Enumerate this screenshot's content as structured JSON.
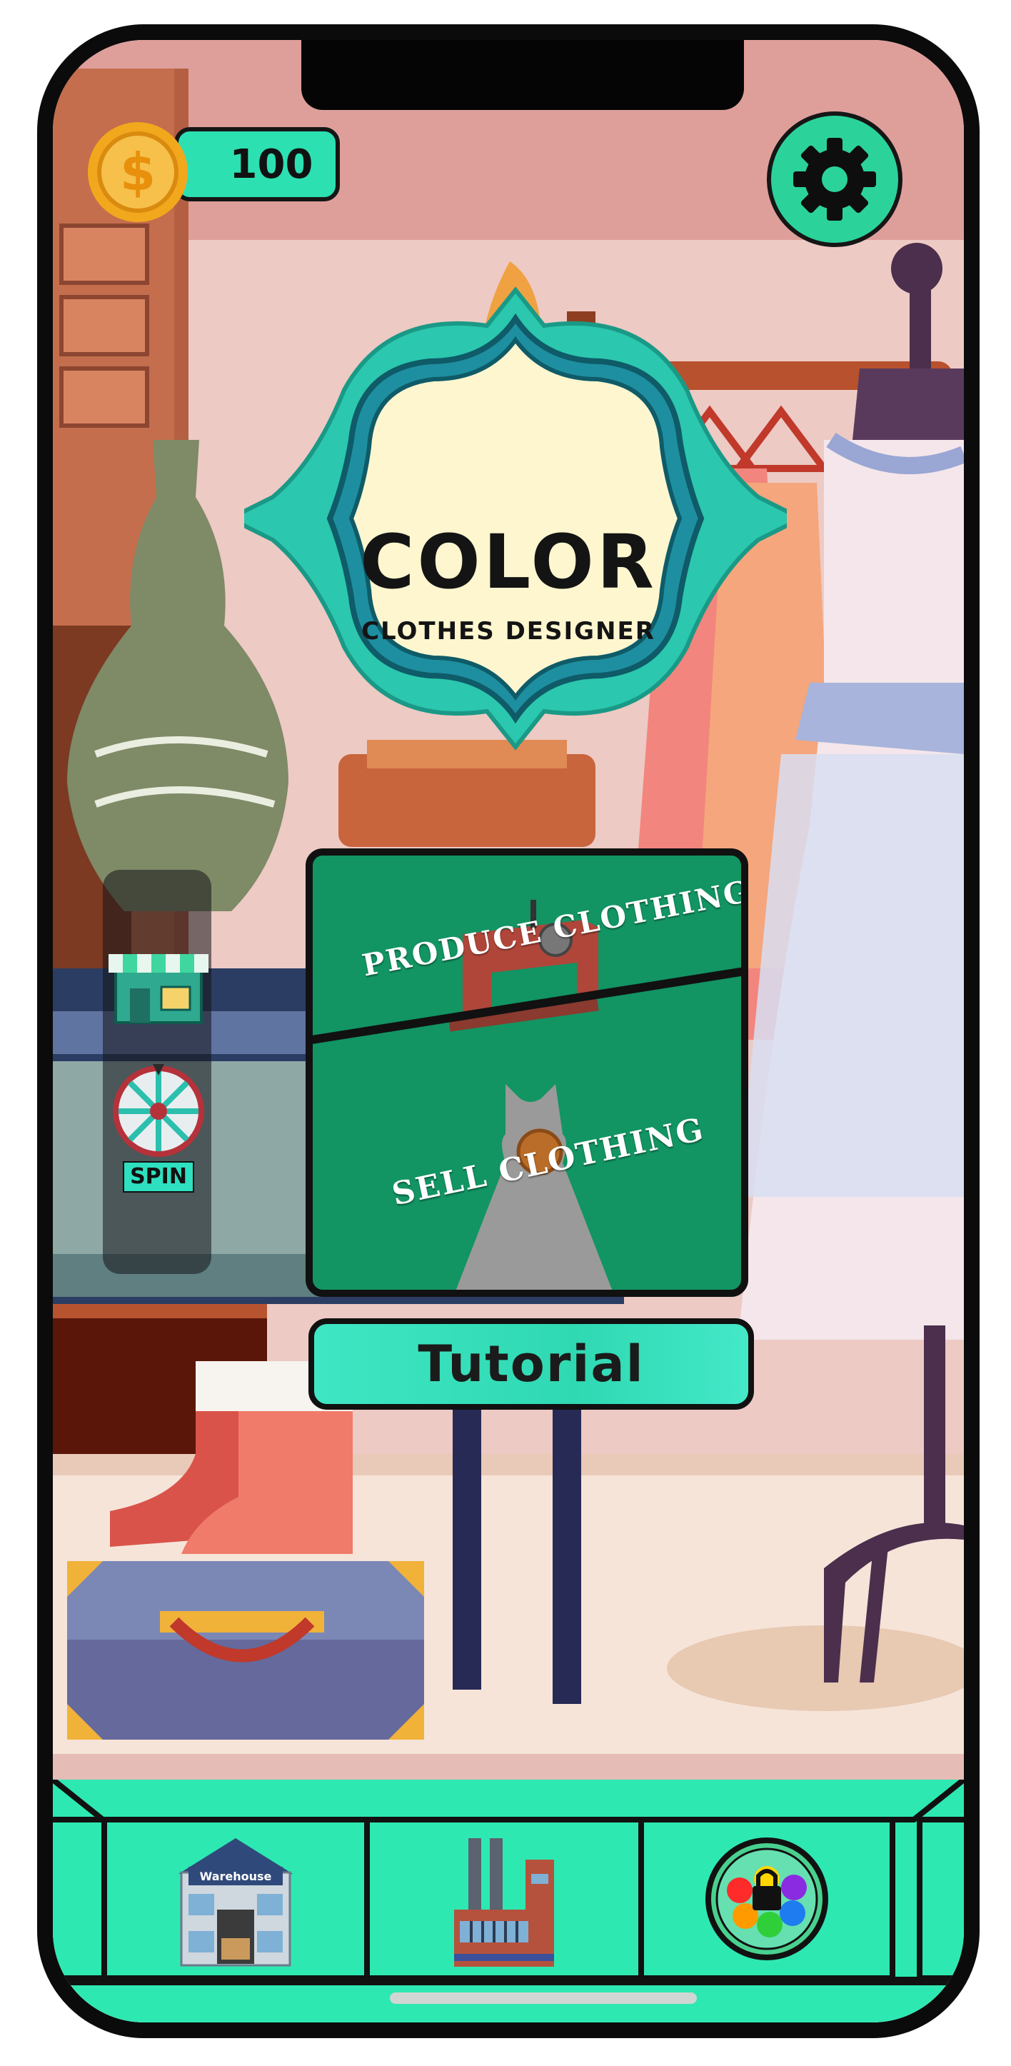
{
  "hud": {
    "coin_icon": "dollar-coin-icon",
    "coins": "100",
    "settings_icon": "gear-icon"
  },
  "title": {
    "main": "COLOR",
    "sub": "CLOTHES DESIGNER"
  },
  "side_menu": {
    "shop_icon": "shop-icon",
    "spin_icon": "wheel-icon",
    "spin_label": "SPIN"
  },
  "actions": {
    "produce_label": "PRODUCE CLOTHING",
    "produce_icon": "sewing-machine-icon",
    "sell_label": "SELL CLOTHING",
    "sell_icon": "dress-coin-icon",
    "tutorial_label": "Tutorial"
  },
  "bottom_nav": {
    "warehouse_label": "Warehouse",
    "warehouse_icon": "warehouse-icon",
    "factory_icon": "factory-icon",
    "palette_icon": "locked-palette-icon"
  },
  "colors": {
    "accent": "#2ee8b2",
    "panel": "#129463",
    "background": "#e9c3bd"
  }
}
